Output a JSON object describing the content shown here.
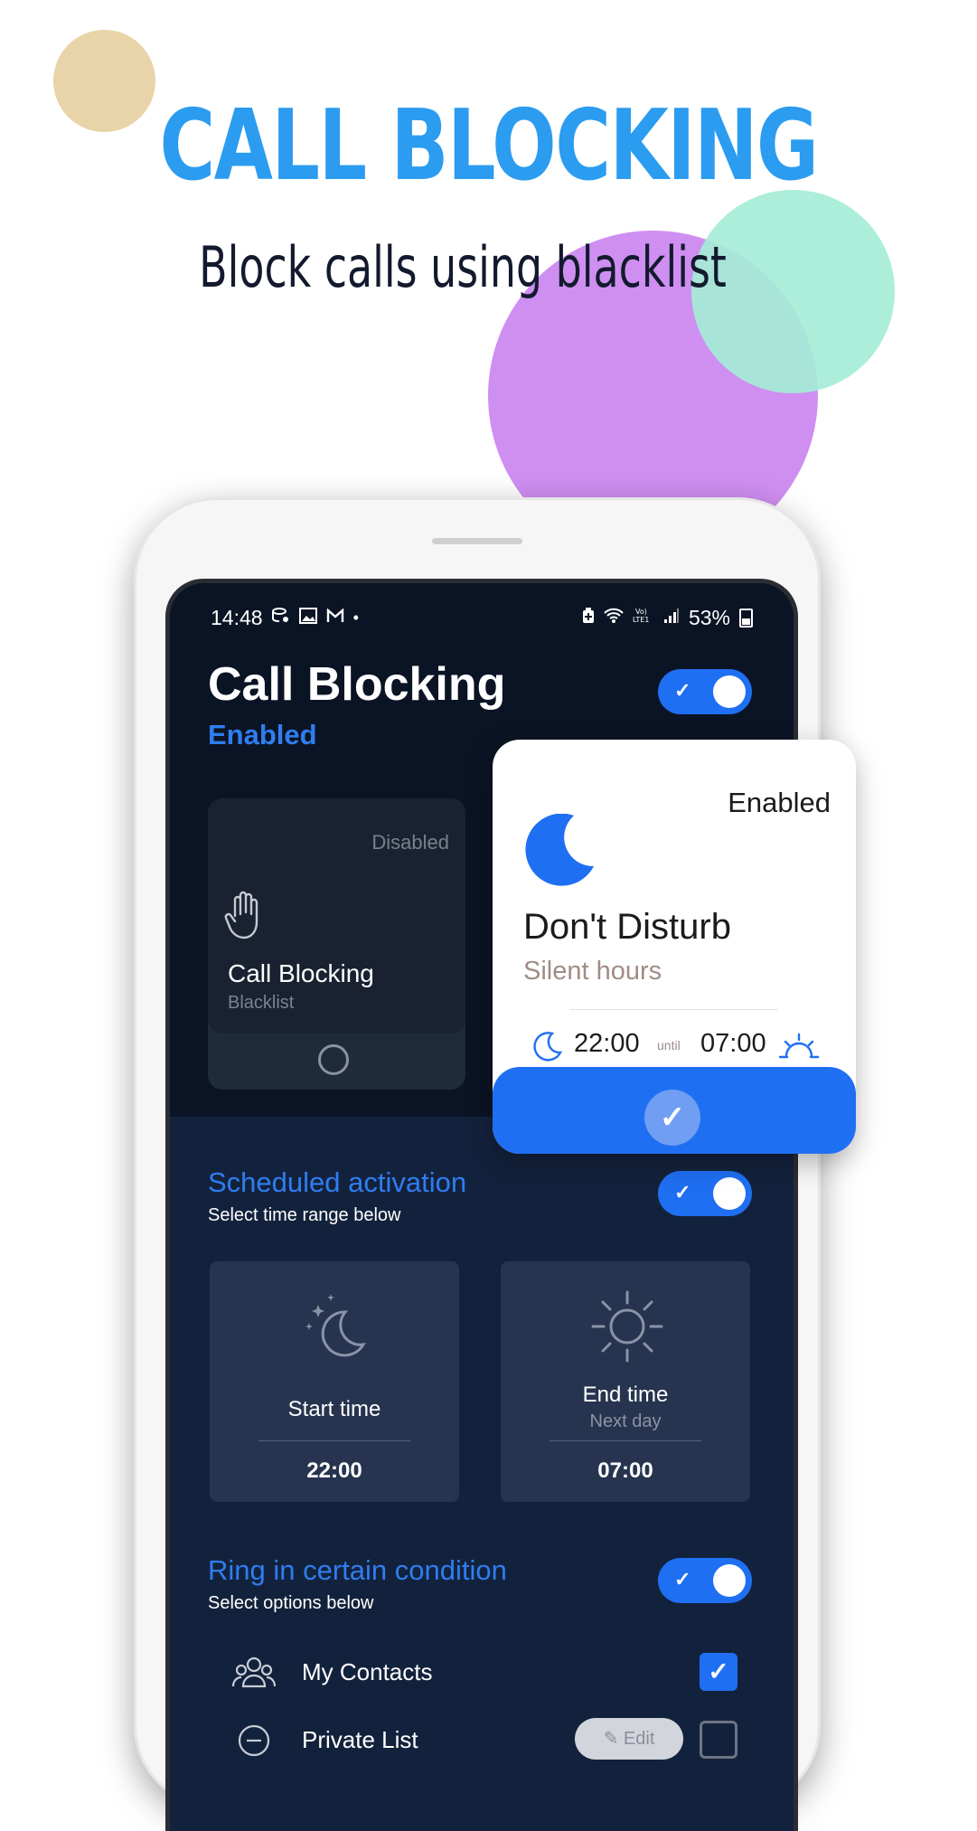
{
  "promo": {
    "headline": "CALL BLOCKING",
    "subline": "Block calls using blacklist"
  },
  "statusbar": {
    "time": "14:48",
    "left_icons": [
      "database-icon",
      "image-icon",
      "gmail-icon",
      "dot-icon"
    ],
    "right_icons": [
      "battery-saver-icon",
      "wifi-icon",
      "volte-icon",
      "signal-icon"
    ],
    "battery": "53%"
  },
  "app": {
    "title": "Call Blocking",
    "status": "Enabled"
  },
  "card": {
    "status": "Disabled",
    "title": "Call Blocking",
    "subtitle": "Blacklist",
    "icon": "hand-icon"
  },
  "popup": {
    "status": "Enabled",
    "title": "Don't Disturb",
    "subtitle": "Silent hours",
    "start": "22:00",
    "until": "until",
    "end": "07:00",
    "icon": "moon-icon"
  },
  "scheduled": {
    "title": "Scheduled activation",
    "subtitle": "Select time range below",
    "start": {
      "label": "Start time",
      "value": "22:00"
    },
    "end": {
      "label": "End time",
      "sub": "Next day",
      "value": "07:00"
    }
  },
  "ring": {
    "title": "Ring in certain condition",
    "subtitle": "Select options below",
    "options": [
      {
        "label": "My Contacts",
        "checked": true
      },
      {
        "label": "Private List",
        "checked": false,
        "action": "Edit"
      }
    ]
  },
  "colors": {
    "accent": "#1f6ff2",
    "headline": "#2b9cf0",
    "screen_bg": "#0b1424",
    "section_bg": "#13223c"
  }
}
